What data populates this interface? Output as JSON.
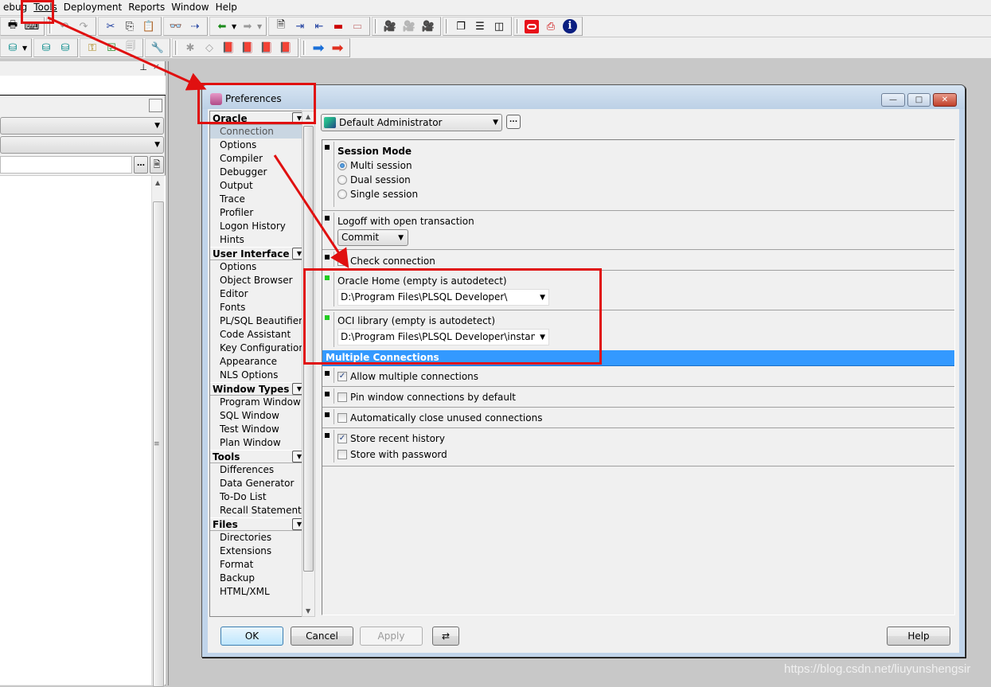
{
  "menubar": {
    "items": [
      {
        "label": "ebug",
        "accel": ""
      },
      {
        "label": "Tools",
        "accel": "T"
      },
      {
        "label": "Deployment",
        "accel": "D"
      },
      {
        "label": "Reports",
        "accel": "R"
      },
      {
        "label": "Window",
        "accel": "W"
      },
      {
        "label": "Help",
        "accel": "H"
      }
    ]
  },
  "toolbar1": {
    "icons": [
      "print-icon",
      "print-setup-icon",
      "undo-icon",
      "redo-icon",
      "cut-icon",
      "copy-icon",
      "paste-icon",
      "find-icon",
      "find-next-icon",
      "import-icon",
      "export-icon",
      "execute-icon",
      "indent-icon",
      "unindent-icon",
      "comment-icon",
      "uncomment-icon",
      "macro-record-icon",
      "macro-play-icon",
      "macro-list-icon",
      "cascade-windows-icon",
      "tile-horizontal-icon",
      "tile-vertical-icon",
      "oracle-logo-icon",
      "pdf-icon",
      "info-icon"
    ]
  },
  "toolbar2": {
    "icons": [
      "sql-icon",
      "logon-icon",
      "logoff-icon",
      "keys-icon",
      "checklist-icon",
      "report-icon",
      "wrench-icon",
      "break-icon",
      "eraser-icon",
      "books-icon",
      "books-folder-icon",
      "books-db-icon",
      "books-edit-icon",
      "arrow-right-blue-icon",
      "arrow-right-red-icon"
    ]
  },
  "left_panel": {
    "pin_glyph": "⊥",
    "close_glyph": "×"
  },
  "preferences": {
    "title": "Preferences",
    "window_buttons": {
      "minimize": "—",
      "maximize": "□",
      "close": "✕"
    },
    "nav": {
      "groups": [
        {
          "label": "Oracle",
          "items": [
            "Connection",
            "Options",
            "Compiler",
            "Debugger",
            "Output",
            "Trace",
            "Profiler",
            "Logon History",
            "Hints"
          ],
          "selected": "Connection"
        },
        {
          "label": "User Interface",
          "items": [
            "Options",
            "Object Browser",
            "Editor",
            "Fonts",
            "PL/SQL Beautifier",
            "Code Assistant",
            "Key Configuration",
            "Appearance",
            "NLS Options"
          ]
        },
        {
          "label": "Window Types",
          "items": [
            "Program Window",
            "SQL Window",
            "Test Window",
            "Plan Window"
          ]
        },
        {
          "label": "Tools",
          "items": [
            "Differences",
            "Data Generator",
            "To-Do List",
            "Recall Statement"
          ]
        },
        {
          "label": "Files",
          "items": [
            "Directories",
            "Extensions",
            "Format",
            "Backup",
            "HTML/XML"
          ]
        }
      ]
    },
    "profile": {
      "value": "Default Administrator",
      "dots": "..."
    },
    "settings": {
      "session_mode": {
        "label": "Session Mode",
        "options": [
          "Multi session",
          "Dual session",
          "Single session"
        ],
        "selected": "Multi session"
      },
      "logoff": {
        "label": "Logoff with open transaction",
        "value": "Commit"
      },
      "check_connection": {
        "label": "Check connection",
        "checked": false
      },
      "oracle_home": {
        "label": "Oracle Home (empty is autodetect)",
        "value": "D:\\Program Files\\PLSQL Developer\\"
      },
      "oci_library": {
        "label": "OCI library (empty is autodetect)",
        "value": "D:\\Program Files\\PLSQL Developer\\instantclient"
      },
      "multiple_connections_header": "Multiple Connections",
      "allow_multiple": {
        "label": "Allow multiple connections",
        "checked": true
      },
      "pin_window": {
        "label": "Pin window connections by default",
        "checked": false
      },
      "auto_close": {
        "label": "Automatically close unused connections",
        "checked": false
      },
      "store_history": {
        "label": "Store recent history",
        "checked": true
      },
      "store_password": {
        "label": "Store with password",
        "checked": false
      }
    },
    "buttons": {
      "ok": "OK",
      "cancel": "Cancel",
      "apply": "Apply",
      "help": "Help"
    }
  },
  "watermark": "https://blog.csdn.net/liuyunshengsir",
  "colors": {
    "annotation_red": "#e01010",
    "section_header_blue": "#3399ff",
    "bullet_green": "#22cc22"
  }
}
